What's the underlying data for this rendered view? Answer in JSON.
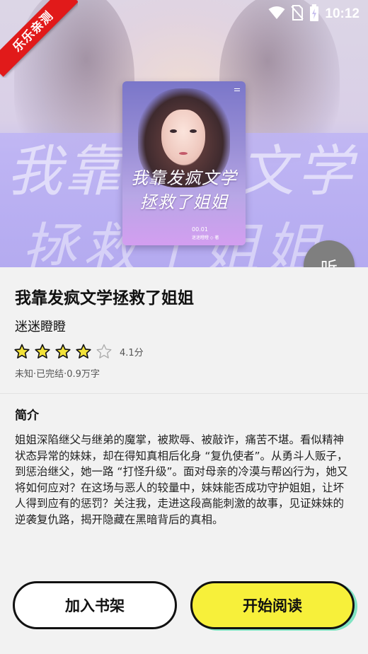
{
  "status_bar": {
    "time": "10:12",
    "icons": [
      "wifi-icon",
      "no-sim-icon",
      "battery-charging-icon"
    ]
  },
  "ribbon": {
    "label": "乐乐亲测"
  },
  "hero": {
    "background_title_line1": "我靠发疯文学",
    "background_title_line2": "拯救了姐姐"
  },
  "cover": {
    "title_line1": "我靠发疯文学",
    "title_line2": "拯救了姐姐",
    "number": "00.01",
    "subtitle": "迷迷瞪瞪 ◇ 著"
  },
  "listen_button": {
    "label": "听"
  },
  "book": {
    "title": "我靠发疯文学拯救了姐姐",
    "author": "迷迷瞪瞪",
    "rating": {
      "value": 4,
      "max": 5,
      "label": "4.1分"
    },
    "meta": "未知·已完结·0.9万字"
  },
  "synopsis": {
    "heading": "简介",
    "text": "姐姐深陷继父与继弟的魔掌，被欺辱、被敲诈，痛苦不堪。看似精神状态异常的妹妹，却在得知真相后化身 “复仇使者”。从勇斗人贩子，到惩治继父，她一路 “打怪升级”。面对母亲的冷漠与帮凶行为，她又将如何应对？在这场与恶人的较量中，妹妹能否成功守护姐姐，让坏人得到应有的惩罚？关注我，走进这段高能刺激的故事，见证妹妹的逆袭复仇路，揭开隐藏在黑暗背后的真相。"
  },
  "actions": {
    "add_to_shelf": "加入书架",
    "start_reading": "开始阅读"
  },
  "colors": {
    "ribbon": "#e11a1a",
    "star_fill": "#f2e23a",
    "read_button": "#f7f03a",
    "read_button_shadow": "#7fe3c2",
    "listen_button": "#7f7f7f"
  }
}
